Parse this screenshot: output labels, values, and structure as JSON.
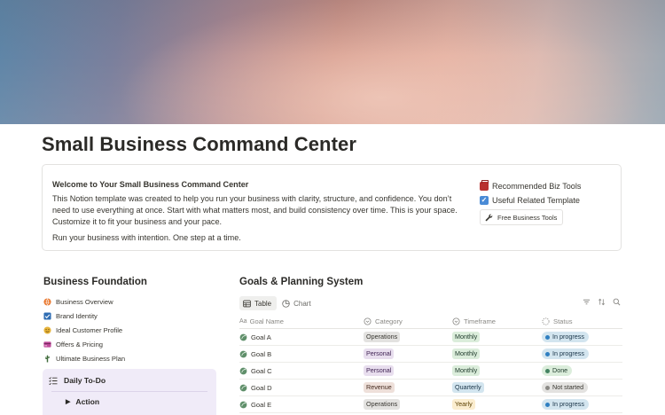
{
  "page": {
    "title": "Small Business Command Center"
  },
  "callout": {
    "welcome": "Welcome to Your Small Business Command Center",
    "body": "This Notion template was created to help you run your business with clarity, structure, and confidence. You don’t need to use everything at once. Start with what matters most, and build consistency over time. This is your space. Customize it to fit your business and your pace.",
    "closing": "Run your business with intention. One step at a time.",
    "links": [
      {
        "label": "Recommended Biz Tools",
        "icon": "toolbox-icon"
      },
      {
        "label": "Useful Related Template",
        "icon": "checkbox-icon"
      }
    ],
    "button": {
      "label": "Free Business Tools",
      "icon": "wrench-icon"
    }
  },
  "foundation": {
    "title": "Business Foundation",
    "items": [
      {
        "label": "Business Overview",
        "icon": "globe-icon",
        "color": "#e9772d"
      },
      {
        "label": "Brand Identity",
        "icon": "checkbox-icon",
        "color": "#2f6db3"
      },
      {
        "label": "Ideal Customer Profile",
        "icon": "smiley-icon",
        "color": "#e7b43a"
      },
      {
        "label": "Offers & Pricing",
        "icon": "credit-card-icon",
        "color": "#c14a9b"
      },
      {
        "label": "Ultimate Business Plan",
        "icon": "cactus-icon",
        "color": "#3f6b3a"
      }
    ]
  },
  "todo": {
    "title": "Daily To-Do",
    "toggle": "Action"
  },
  "goals": {
    "title": "Goals & Planning System",
    "views": [
      {
        "label": "Table",
        "icon": "table-icon",
        "active": true
      },
      {
        "label": "Chart",
        "icon": "chart-icon",
        "active": false
      }
    ],
    "tools": [
      "filter-icon",
      "sort-icon",
      "search-icon"
    ],
    "columns": [
      "Goal Name",
      "Category",
      "Timeframe",
      "Status"
    ],
    "rows": [
      {
        "name": "Goal A",
        "category": "Operations",
        "category_color": "gray",
        "timeframe": "Monthly",
        "timeframe_color": "green",
        "status": "In progress",
        "status_color": "blue"
      },
      {
        "name": "Goal B",
        "category": "Personal",
        "category_color": "purple",
        "timeframe": "Monthly",
        "timeframe_color": "green",
        "status": "In progress",
        "status_color": "blue"
      },
      {
        "name": "Goal C",
        "category": "Personal",
        "category_color": "purple",
        "timeframe": "Monthly",
        "timeframe_color": "green",
        "status": "Done",
        "status_color": "green"
      },
      {
        "name": "Goal D",
        "category": "Revenue",
        "category_color": "brown",
        "timeframe": "Quarterly",
        "timeframe_color": "blue",
        "status": "Not started",
        "status_color": "gray"
      },
      {
        "name": "Goal E",
        "category": "Operations",
        "category_color": "gray",
        "timeframe": "Yearly",
        "timeframe_color": "yellow",
        "status": "In progress",
        "status_color": "blue"
      }
    ]
  }
}
